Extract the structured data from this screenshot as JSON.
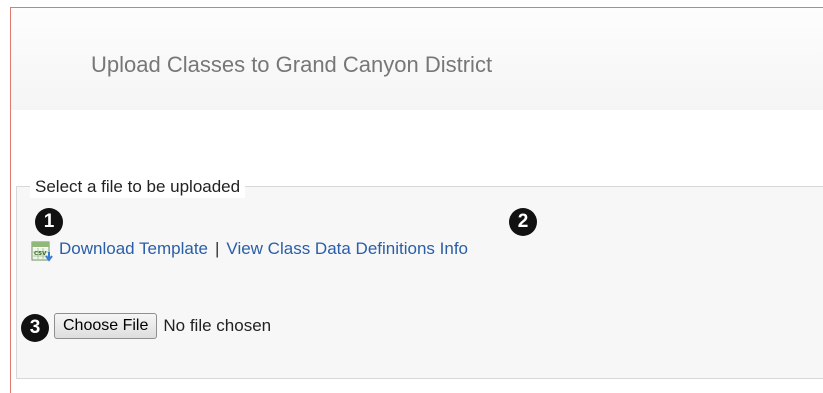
{
  "header": {
    "title": "Upload Classes to Grand Canyon District"
  },
  "upload_section": {
    "legend": "Select a file to be uploaded",
    "csv_icon": "csv-file-download-icon",
    "download_template_link": "Download Template",
    "separator": "|",
    "view_definitions_link": "View Class Data Definitions Info",
    "choose_file_button": "Choose File",
    "file_status": "No file chosen"
  },
  "annotations": {
    "step_1": "1",
    "step_2": "2",
    "step_3": "3"
  },
  "colors": {
    "link": "#2a5ea8",
    "frame_border": "#e07a70",
    "title": "#777777",
    "badge": "#111111"
  }
}
